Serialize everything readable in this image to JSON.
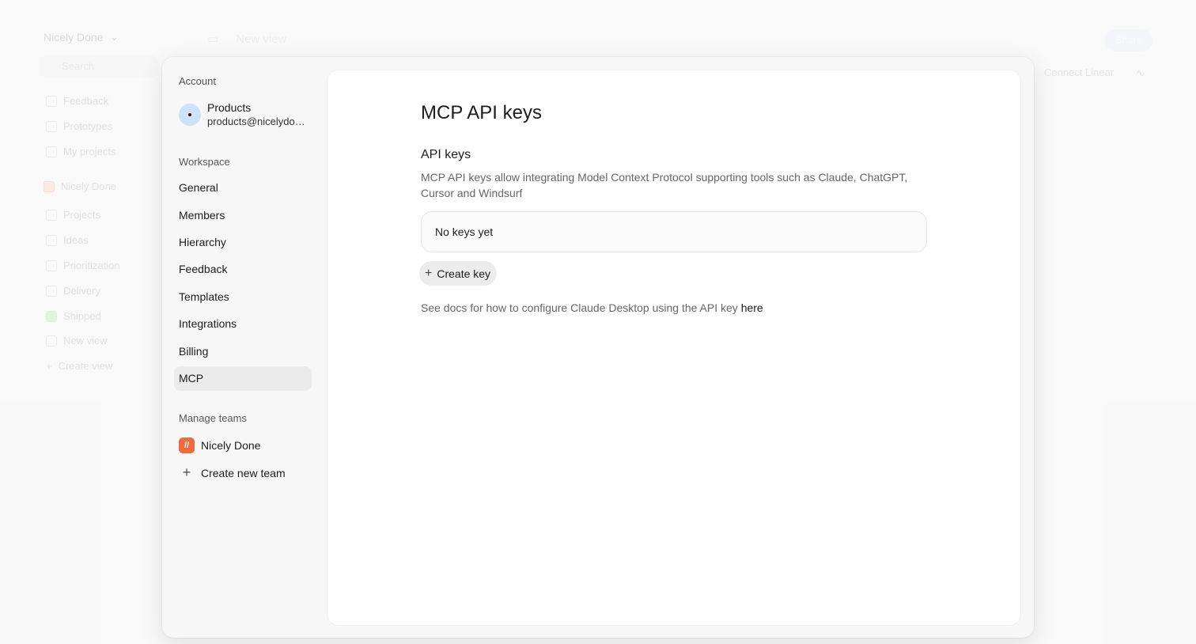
{
  "background": {
    "workspace_name": "Nicely Done",
    "search_placeholder": "Search",
    "nav_top": [
      "Feedback",
      "Prototypes",
      "My projects"
    ],
    "team_name": "Nicely Done",
    "team_nav": [
      "Projects",
      "Ideas",
      "Prioritization",
      "Delivery",
      "Shipped",
      "New view",
      "Create view"
    ],
    "header_title": "New view",
    "share_label": "Share",
    "connect_label": "Connect Linear"
  },
  "sidebar": {
    "account_label": "Account",
    "account_name": "Products",
    "account_email": "products@nicelydone.club",
    "workspace_label": "Workspace",
    "items": [
      {
        "label": "General"
      },
      {
        "label": "Members"
      },
      {
        "label": "Hierarchy"
      },
      {
        "label": "Feedback"
      },
      {
        "label": "Templates"
      },
      {
        "label": "Integrations"
      },
      {
        "label": "Billing"
      },
      {
        "label": "MCP"
      }
    ],
    "active_item": "MCP",
    "manage_label": "Manage teams",
    "team_name": "Nicely Done",
    "create_team_label": "Create new team"
  },
  "main": {
    "title": "MCP API keys",
    "section_title": "API keys",
    "description": "MCP API keys allow integrating Model Context Protocol supporting tools such as Claude, ChatGPT, Cursor and Windsurf",
    "empty_state": "No keys yet",
    "create_label": "Create key",
    "docs_text": "See docs for how to configure Claude Desktop using the API key",
    "docs_link": "here"
  },
  "colors": {
    "accent_avatar": "#cfe2fb",
    "team_logo": "#ef6b3d",
    "share_button": "#dbe8f9"
  }
}
